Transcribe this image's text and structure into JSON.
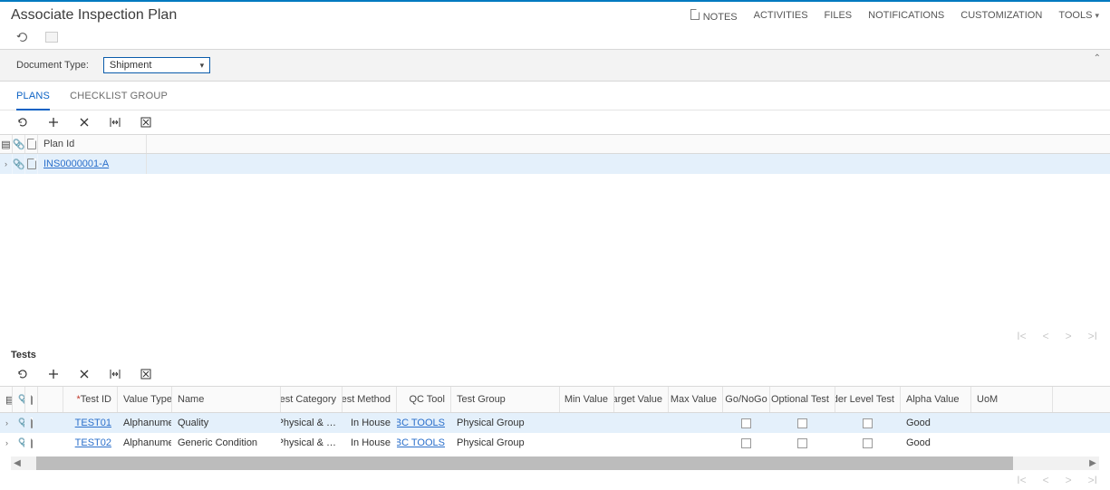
{
  "header": {
    "title": "Associate Inspection Plan",
    "links": {
      "notes": "NOTES",
      "activities": "ACTIVITIES",
      "files": "FILES",
      "notifications": "NOTIFICATIONS",
      "customization": "CUSTOMIZATION",
      "tools": "TOOLS"
    }
  },
  "form": {
    "doc_type_label": "Document Type:",
    "doc_type_value": "Shipment"
  },
  "tabs": {
    "plans": "PLANS",
    "checklist": "CHECKLIST GROUP"
  },
  "plans_grid": {
    "col_plan_id": "Plan Id",
    "rows": [
      {
        "plan_id": "INS0000001-A"
      }
    ]
  },
  "tests": {
    "title": "Tests",
    "columns": {
      "test_id": "Test ID",
      "value_type": "Value Type",
      "name": "Name",
      "test_category": "Test Category",
      "test_method": "Test Method",
      "qc_tool": "QC Tool",
      "test_group": "Test Group",
      "min_value": "Min Value",
      "target_value": "Target Value",
      "max_value": "Max Value",
      "go_nogo": "Go/NoGo",
      "optional_test": "Optional Test",
      "order_level_test": "Order Level Test",
      "alpha_value": "Alpha Value",
      "uom": "UoM"
    },
    "rows": [
      {
        "test_id": "TEST01",
        "value_type": "Alphanumeric",
        "name": "Quality",
        "test_category": "Physical & …",
        "test_method": "In House",
        "qc_tool": "ABC TOOLS",
        "test_group": "Physical Group",
        "alpha_value": "Good"
      },
      {
        "test_id": "TEST02",
        "value_type": "Alphanumeric",
        "name": "Generic Condition",
        "test_category": "Physical & …",
        "test_method": "In House",
        "qc_tool": "ABC TOOLS",
        "test_group": "Physical Group",
        "alpha_value": "Good"
      }
    ]
  }
}
